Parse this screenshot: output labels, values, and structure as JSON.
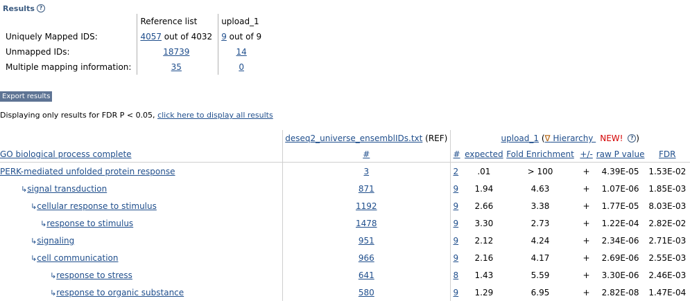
{
  "results": {
    "title": "Results",
    "help": "?"
  },
  "mapping": {
    "col_ref": "Reference list",
    "col_up": "upload_1",
    "rows": [
      {
        "label": "Uniquely Mapped IDS:",
        "ref_link": "4057",
        "ref_rest": " out of 4032",
        "up_link": "9",
        "up_rest": " out of 9"
      },
      {
        "label": "Unmapped IDs:",
        "ref_link": "18739",
        "ref_rest": "",
        "up_link": "14",
        "up_rest": ""
      },
      {
        "label": "Multiple mapping information:",
        "ref_link": "35",
        "ref_rest": "",
        "up_link": "0",
        "up_rest": ""
      }
    ]
  },
  "export_label": "Export results",
  "fdr_note": {
    "text": "Displaying only results for FDR P < 0.05, ",
    "link": "click here to display all results"
  },
  "table": {
    "ref_file": "deseq2_universe_ensemblIDs.txt",
    "ref_suffix": " (REF)",
    "upload_name": "upload_1",
    "hier_open": " (",
    "hier_icon": "∇",
    "hier_label": " Hierarchy ",
    "new_label": "NEW!",
    "hier_close": ")",
    "headers": {
      "go": "GO biological process complete",
      "ref_n": "#",
      "n": "#",
      "expected": "expected",
      "fe": "Fold Enrichment",
      "dir": "+/-",
      "p": "raw P value",
      "fdr": "FDR"
    },
    "rows": [
      {
        "indent": 0,
        "arrow": "",
        "term": "PERK-mediated unfolded protein response",
        "ref": "3",
        "n": "2",
        "expected": ".01",
        "fe": "> 100",
        "dir": "+",
        "p": "4.39E-05",
        "fdr": "1.53E-02"
      },
      {
        "indent": 1,
        "arrow": "↳",
        "term": "signal transduction",
        "ref": "871",
        "n": "9",
        "expected": "1.94",
        "fe": "4.63",
        "dir": "+",
        "p": "1.07E-06",
        "fdr": "1.85E-03"
      },
      {
        "indent": 2,
        "arrow": "↳",
        "term": "cellular response to stimulus",
        "ref": "1192",
        "n": "9",
        "expected": "2.66",
        "fe": "3.38",
        "dir": "+",
        "p": "1.77E-05",
        "fdr": "8.03E-03"
      },
      {
        "indent": 3,
        "arrow": "↳",
        "term": "response to stimulus",
        "ref": "1478",
        "n": "9",
        "expected": "3.30",
        "fe": "2.73",
        "dir": "+",
        "p": "1.22E-04",
        "fdr": "2.82E-02"
      },
      {
        "indent": 2,
        "arrow": "↳",
        "term": "signaling",
        "ref": "951",
        "n": "9",
        "expected": "2.12",
        "fe": "4.24",
        "dir": "+",
        "p": "2.34E-06",
        "fdr": "2.71E-03"
      },
      {
        "indent": 2,
        "arrow": "↳",
        "term": "cell communication",
        "ref": "966",
        "n": "9",
        "expected": "2.16",
        "fe": "4.17",
        "dir": "+",
        "p": "2.69E-06",
        "fdr": "2.55E-03"
      },
      {
        "indent": 4,
        "arrow": "↳",
        "term": "response to stress",
        "ref": "641",
        "n": "8",
        "expected": "1.43",
        "fe": "5.59",
        "dir": "+",
        "p": "3.30E-06",
        "fdr": "2.46E-03"
      },
      {
        "indent": 4,
        "arrow": "↳",
        "term": "response to organic substance",
        "ref": "580",
        "n": "9",
        "expected": "1.29",
        "fe": "6.95",
        "dir": "+",
        "p": "2.82E-08",
        "fdr": "1.47E-04"
      }
    ]
  }
}
